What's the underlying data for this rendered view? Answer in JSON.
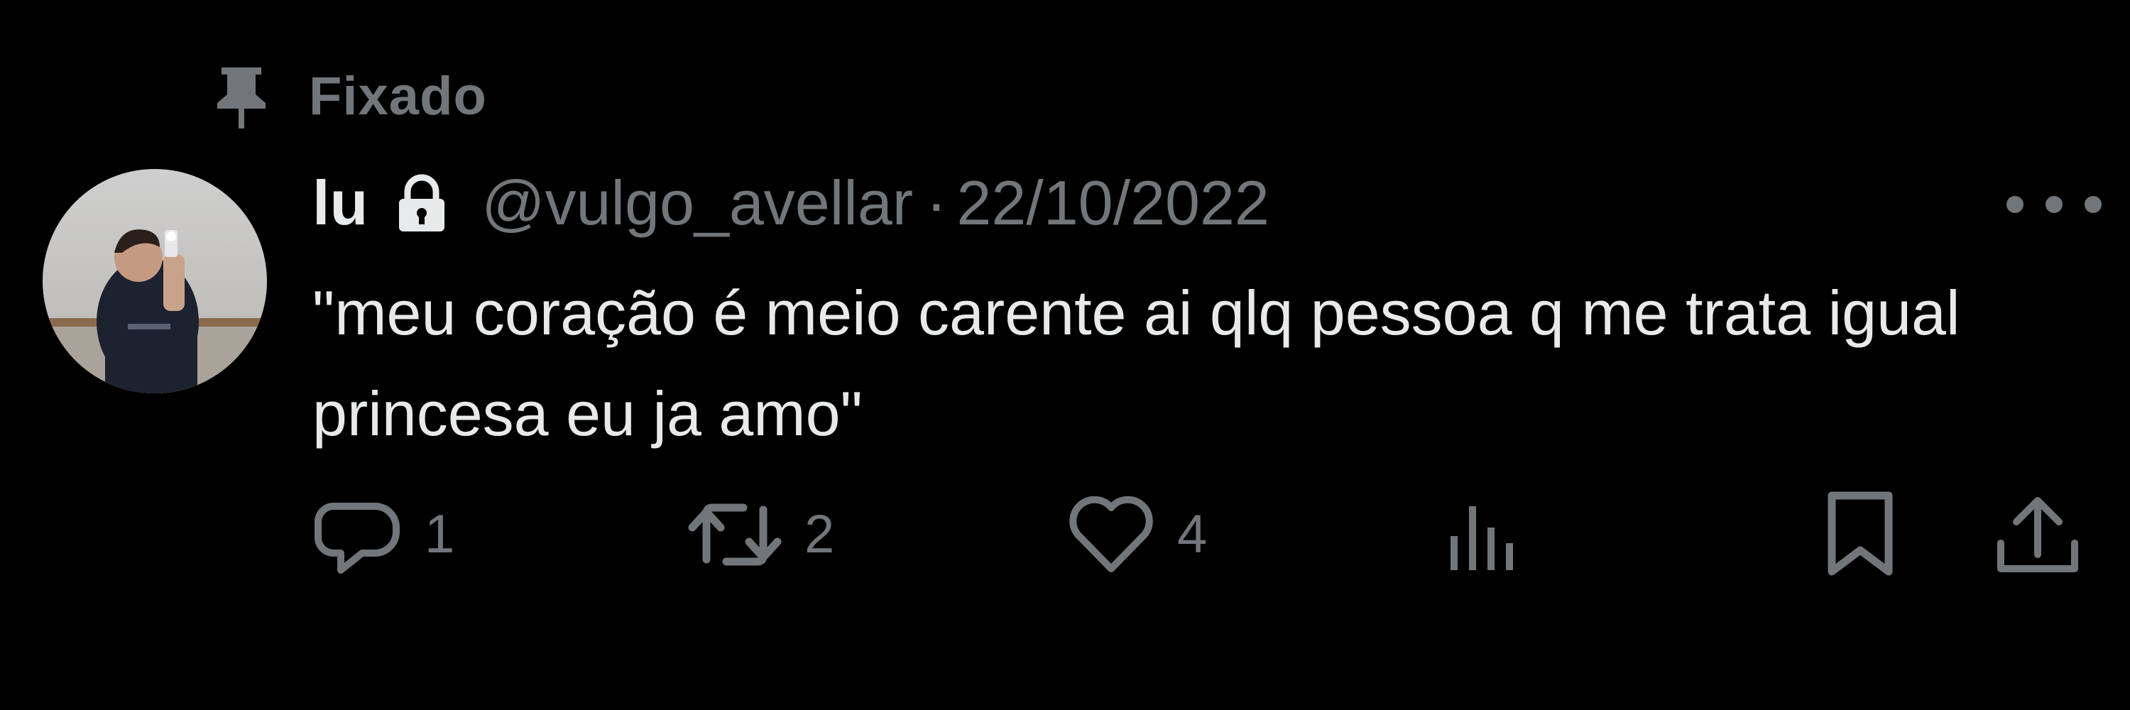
{
  "pinned": {
    "icon": "pin-icon",
    "label": "Fixado"
  },
  "tweet": {
    "author": {
      "display_name": "lu",
      "protected_icon": "lock-icon",
      "handle": "@vulgo_avellar",
      "avatar": "avatar-photo"
    },
    "separator": "·",
    "date": "22/10/2022",
    "text": "\"meu coração é meio carente ai qlq pessoa q me trata igual princesa eu ja amo\"",
    "more_icon": "more-dots-icon",
    "actions": {
      "reply": {
        "icon": "reply-icon",
        "count": "1"
      },
      "retweet": {
        "icon": "retweet-icon",
        "count": "2"
      },
      "like": {
        "icon": "heart-icon",
        "count": "4"
      },
      "views": {
        "icon": "views-icon"
      },
      "bookmark": {
        "icon": "bookmark-icon"
      },
      "share": {
        "icon": "share-icon"
      }
    }
  },
  "colors": {
    "background": "#000000",
    "primary_text": "#e7e9ea",
    "secondary_text": "#71767b"
  }
}
